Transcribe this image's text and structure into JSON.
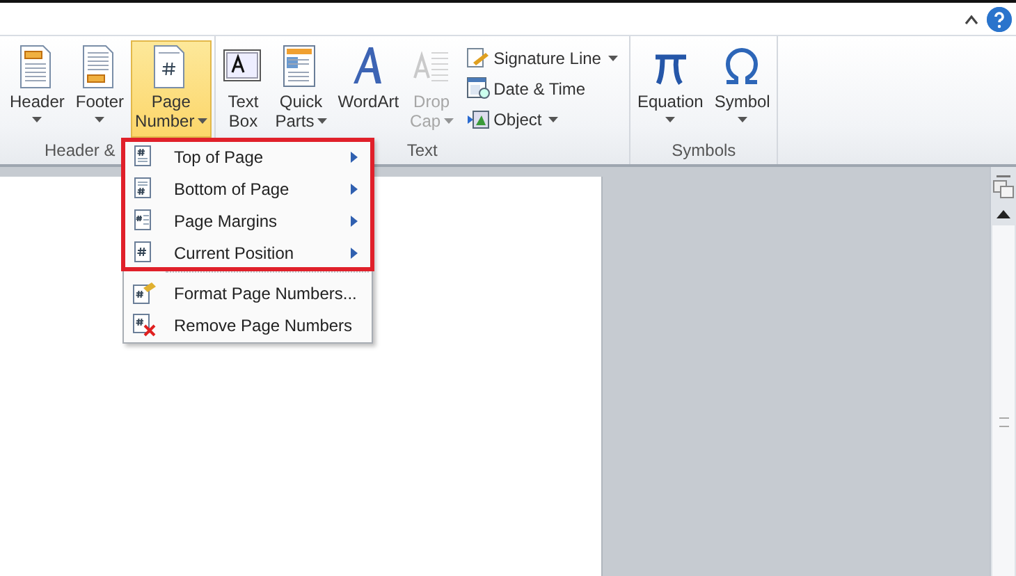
{
  "ribbon": {
    "groups": [
      {
        "label": "Header &",
        "buttons": [
          {
            "lines": [
              "Header"
            ],
            "dropdown": true,
            "selected": false,
            "disabled": false
          },
          {
            "lines": [
              "Footer"
            ],
            "dropdown": true,
            "selected": false,
            "disabled": false
          },
          {
            "lines": [
              "Page",
              "Number"
            ],
            "dropdown": true,
            "selected": true,
            "disabled": false
          }
        ]
      },
      {
        "label": "Text",
        "buttons": [
          {
            "lines": [
              "Text",
              "Box"
            ],
            "dropdown": false,
            "selected": false,
            "disabled": false
          },
          {
            "lines": [
              "Quick",
              "Parts"
            ],
            "dropdown": true,
            "selected": false,
            "disabled": false
          },
          {
            "lines": [
              "WordArt"
            ],
            "dropdown": false,
            "selected": false,
            "disabled": false
          },
          {
            "lines": [
              "Drop",
              "Cap"
            ],
            "dropdown": true,
            "selected": false,
            "disabled": true
          }
        ],
        "small_buttons": [
          {
            "label": "Signature Line",
            "dropdown": true
          },
          {
            "label": "Date & Time",
            "dropdown": false
          },
          {
            "label": "Object",
            "dropdown": true
          }
        ]
      },
      {
        "label": "Symbols",
        "buttons": [
          {
            "lines": [
              "Equation"
            ],
            "dropdown": true,
            "selected": false,
            "disabled": false
          },
          {
            "lines": [
              "Symbol"
            ],
            "dropdown": true,
            "selected": false,
            "disabled": false
          }
        ]
      }
    ]
  },
  "menu": {
    "sections": [
      {
        "highlighted": true,
        "items": [
          {
            "label": "Top of Page",
            "submenu": true
          },
          {
            "label": "Bottom of Page",
            "submenu": true
          },
          {
            "label": "Page Margins",
            "submenu": true
          },
          {
            "label": "Current Position",
            "submenu": true
          }
        ]
      },
      {
        "highlighted": false,
        "items": [
          {
            "label": "Format Page Numbers...",
            "submenu": false
          },
          {
            "label": "Remove Page Numbers",
            "submenu": false
          }
        ]
      }
    ]
  }
}
